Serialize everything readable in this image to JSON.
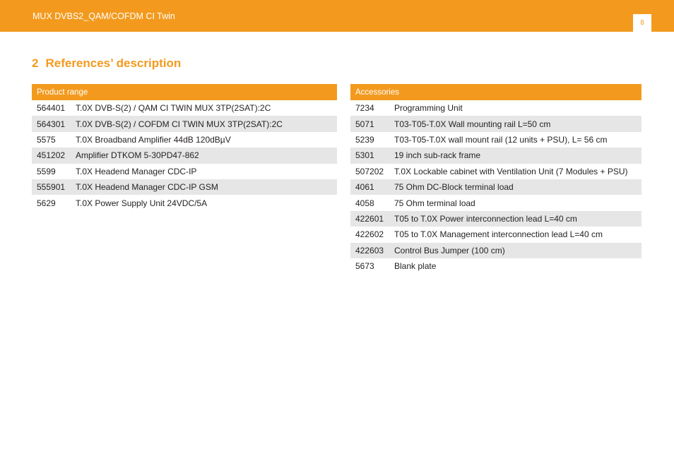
{
  "header": {
    "title": "MUX DVBS2_QAM/COFDM CI Twin",
    "page_number": "8"
  },
  "section": {
    "number": "2",
    "title": "References’ description"
  },
  "product_range": {
    "header": "Product range",
    "rows": [
      {
        "code": "564401",
        "desc": "T.0X DVB-S(2) / QAM CI TWIN MUX 3TP(2SAT):2C"
      },
      {
        "code": "564301",
        "desc": "T.0X DVB-S(2) / COFDM CI TWIN MUX 3TP(2SAT):2C"
      },
      {
        "code": "5575",
        "desc": "T.0X Broadband Amplifier 44dB 120dBµV"
      },
      {
        "code": "451202",
        "desc": "Amplifier DTKOM 5-30PD47-862"
      },
      {
        "code": "5599",
        "desc": "T.0X Headend Manager CDC-IP"
      },
      {
        "code": "555901",
        "desc": "T.0X Headend Manager CDC-IP GSM"
      },
      {
        "code": "5629",
        "desc": "T.0X Power Supply Unit 24VDC/5A"
      }
    ]
  },
  "accessories": {
    "header": "Accessories",
    "rows": [
      {
        "code": "7234",
        "desc": "Programming Unit"
      },
      {
        "code": "5071",
        "desc": "T03-T05-T.0X Wall mounting rail L=50 cm"
      },
      {
        "code": "5239",
        "desc": "T03-T05-T.0X wall mount rail (12 units + PSU), L= 56 cm"
      },
      {
        "code": "5301",
        "desc": "19 inch sub-rack frame"
      },
      {
        "code": "507202",
        "desc": "T.0X Lockable cabinet with Ventilation Unit (7 Modules + PSU)"
      },
      {
        "code": "4061",
        "desc": "75 Ohm DC-Block terminal load"
      },
      {
        "code": "4058",
        "desc": "75 Ohm terminal load"
      },
      {
        "code": "422601",
        "desc": "T05 to T.0X Power interconnection lead L=40 cm"
      },
      {
        "code": "422602",
        "desc": "T05 to T.0X Management interconnection lead L=40 cm"
      },
      {
        "code": "422603",
        "desc": "Control Bus Jumper (100 cm)"
      },
      {
        "code": "5673",
        "desc": "Blank plate"
      }
    ]
  },
  "colors": {
    "accent": "#f39a1e",
    "row_shade": "#e6e6e7"
  }
}
